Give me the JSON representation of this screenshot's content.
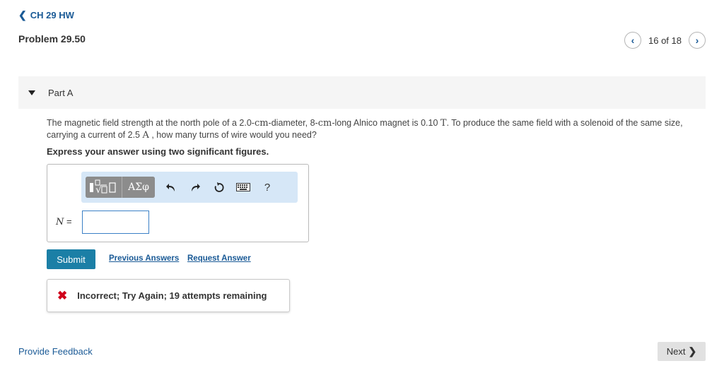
{
  "nav": {
    "back_label": "CH 29 HW"
  },
  "problem": {
    "title": "Problem 29.50"
  },
  "pager": {
    "count": "16 of 18"
  },
  "part": {
    "label": "Part A"
  },
  "question": {
    "t1": "The magnetic field strength at the north pole of a 2.0-",
    "u1": "cm",
    "t2": "-diameter, 8-",
    "u2": "cm",
    "t3": "-long Alnico magnet is 0.10 ",
    "u3": "T",
    "t4": ". To produce the same field with a solenoid of the same size, carrying a current of 2.5 ",
    "u4": "A",
    "t5": " , how many turns of wire would you need?"
  },
  "instruction": "Express your answer using two significant figures.",
  "toolbar": {
    "greek_label": "ΑΣφ",
    "help_label": "?"
  },
  "answer": {
    "variable": "N",
    "equals": "=",
    "value": ""
  },
  "actions": {
    "submit_label": "Submit",
    "previous_answers_label": "Previous Answers",
    "request_answer_label": "Request Answer"
  },
  "feedback": {
    "message": "Incorrect; Try Again; 19 attempts remaining",
    "status_color": "#d0021b"
  },
  "footer": {
    "provide_feedback_label": "Provide Feedback",
    "next_label": "Next"
  }
}
